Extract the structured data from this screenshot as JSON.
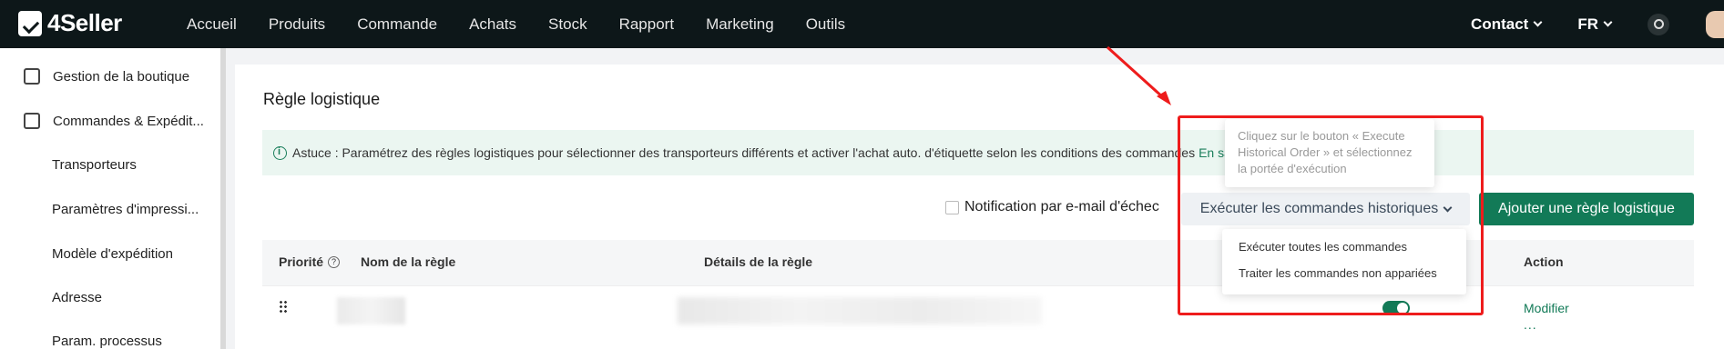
{
  "brand": {
    "name": "4Seller"
  },
  "topnav": {
    "items": [
      "Accueil",
      "Produits",
      "Commande",
      "Achats",
      "Stock",
      "Rapport",
      "Marketing",
      "Outils"
    ],
    "contact": "Contact",
    "lang": "FR"
  },
  "sidebar": {
    "groups": [
      {
        "label": "Gestion de la boutique",
        "icon": "shop-icon"
      },
      {
        "label": "Commandes & Expédit...",
        "icon": "order-icon"
      }
    ],
    "subitems": [
      "Transporteurs",
      "Paramètres d'impressi...",
      "Modèle d'expédition",
      "Adresse",
      "Param. processus"
    ]
  },
  "page": {
    "title": "Règle logistique",
    "tip_text": "Astuce : Paramétrez des règles logistiques pour sélectionner des transporteurs différents et activer l'achat auto. d'étiquette selon les conditions des commandes",
    "tip_link": "En sa",
    "notif_label": "Notification par e-mail d'échec",
    "exec_button": "Exécuter les commandes historiques",
    "add_button": "Ajouter une règle logistique"
  },
  "table": {
    "headers": {
      "priority": "Priorité",
      "name": "Nom de la règle",
      "details": "Détails de la règle",
      "action": "Action"
    },
    "row": {
      "action_edit": "Modifier",
      "action_more": "..."
    }
  },
  "tooltip": {
    "text": "Cliquez sur le bouton « Execute Historical Order » et sélectionnez la portée d'exécution"
  },
  "dropdown": {
    "options": [
      "Exécuter toutes les commandes",
      "Traiter les commandes non appariées"
    ]
  },
  "colors": {
    "brand_green": "#127a57",
    "annotation_red": "#ee1c1c",
    "topbar": "#0d1719"
  }
}
